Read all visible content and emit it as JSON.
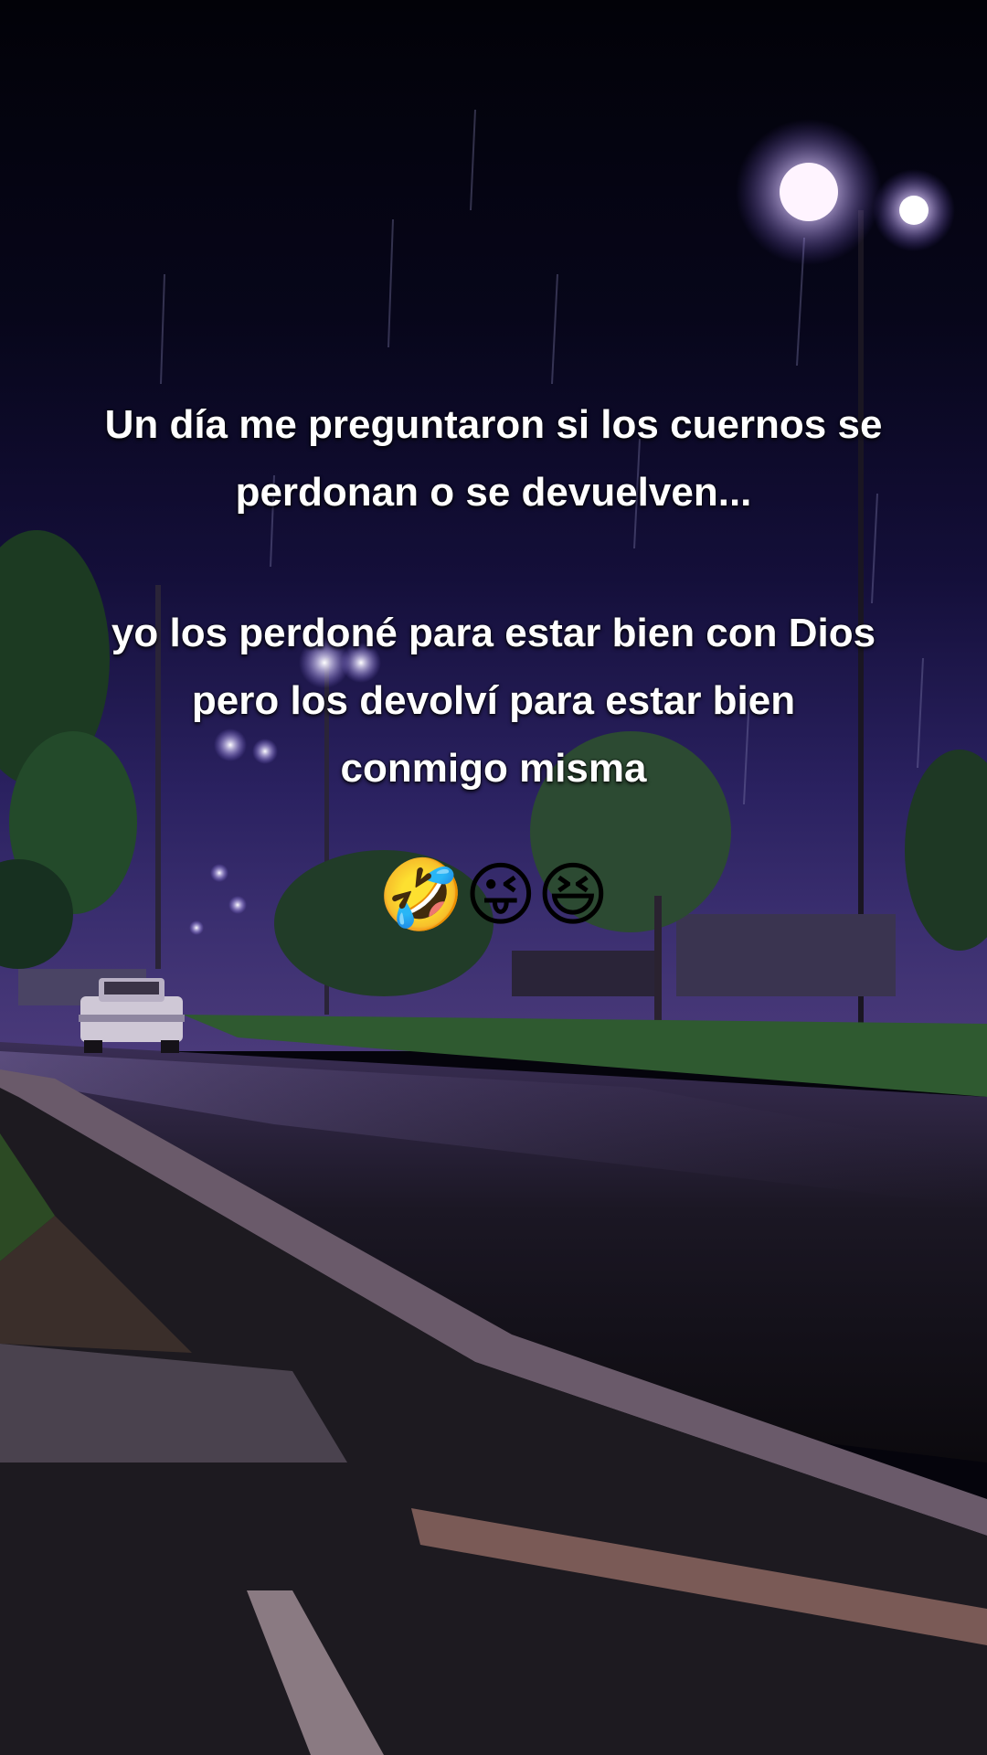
{
  "caption": {
    "part1_line1": "Un día me preguntaron si los cuernos se",
    "part1_line2": "perdonan o se devuelven...",
    "part2_line1": "yo los perdoné para estar bien con Dios",
    "part2_line2": "pero los devolví para estar bien",
    "part2_line3": "conmigo misma",
    "emojis": "🤣😜😆"
  },
  "colors": {
    "sky_top": "#020208",
    "sky_glow": "#4a3a7a",
    "street_light": "#e8d8ff",
    "text": "#ffffff"
  }
}
